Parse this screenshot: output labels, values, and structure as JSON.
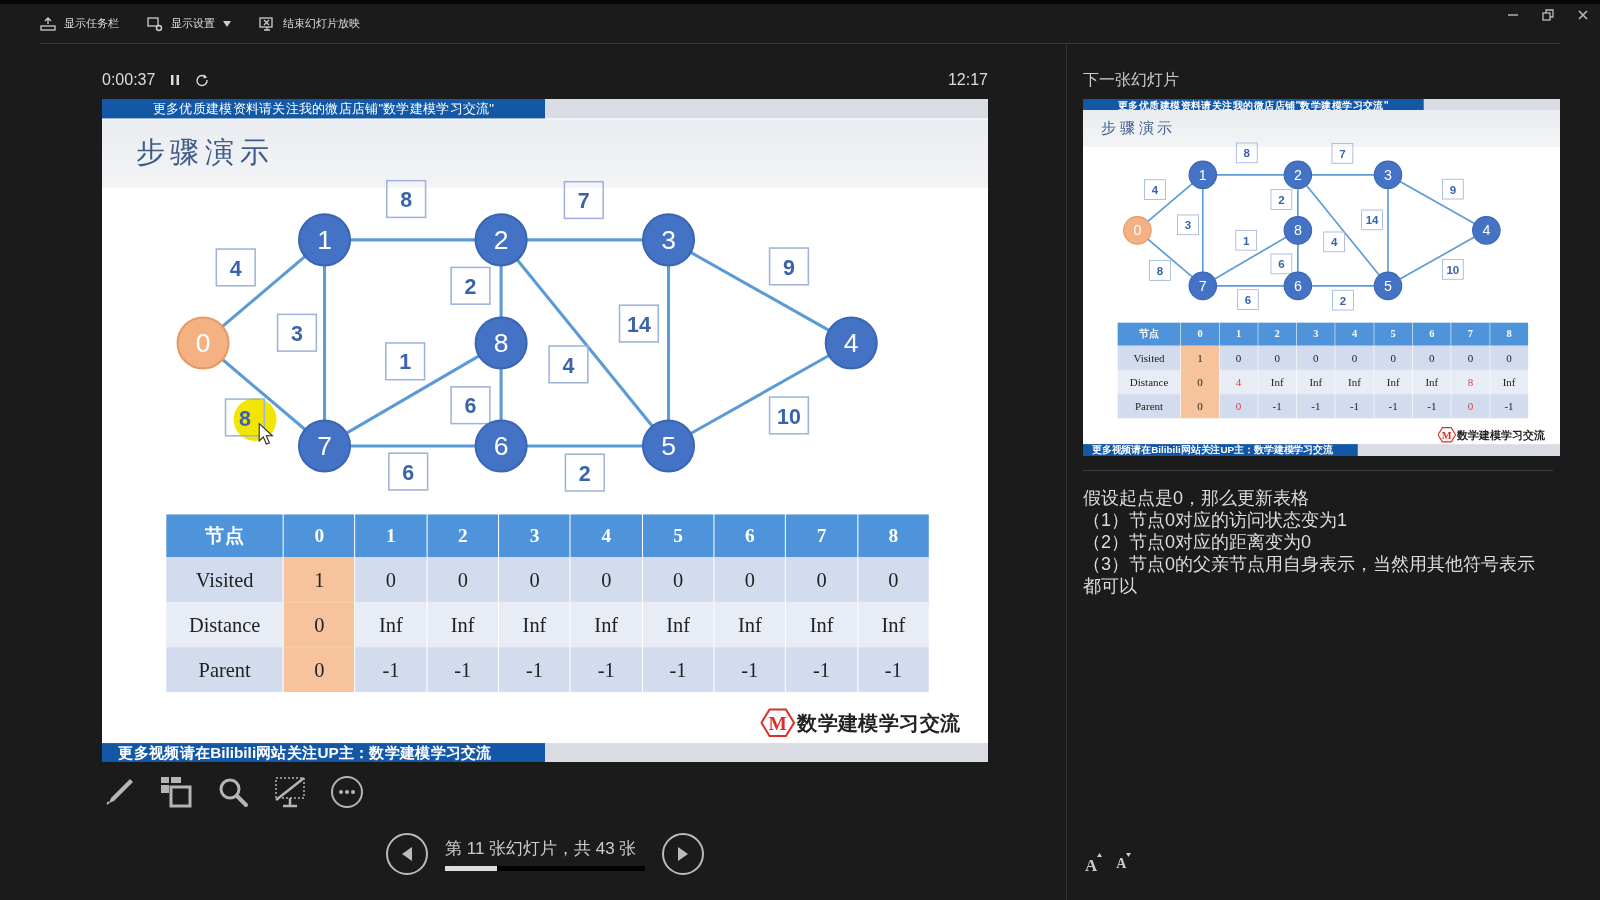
{
  "toolbar": [
    {
      "label": "显示任务栏",
      "kind": "taskbar",
      "dropdown": false
    },
    {
      "label": "显示设置",
      "kind": "settings",
      "dropdown": true
    },
    {
      "label": "结束幻灯片放映",
      "kind": "end",
      "dropdown": false
    }
  ],
  "timer": {
    "elapsed": "0:00:37",
    "clock": "12:17"
  },
  "current_slide": {
    "banner_top": "更多优质建模资料请关注我的微店店铺\"数学建模学习交流\"",
    "title": "步骤演示",
    "nodes": [
      {
        "label": "1",
        "highlighted": false
      },
      {
        "label": "2",
        "highlighted": false
      },
      {
        "label": "3",
        "highlighted": false
      },
      {
        "label": "0",
        "highlighted": true
      },
      {
        "label": "8",
        "highlighted": false
      },
      {
        "label": "4",
        "highlighted": false
      },
      {
        "label": "7",
        "highlighted": false
      },
      {
        "label": "6",
        "highlighted": false
      },
      {
        "label": "5",
        "highlighted": false
      }
    ],
    "edges": [
      {
        "weight": "4"
      },
      {
        "weight": "8"
      },
      {
        "weight": "3"
      },
      {
        "weight": "8"
      },
      {
        "weight": "1"
      },
      {
        "weight": "6"
      },
      {
        "weight": "2"
      },
      {
        "weight": "6"
      },
      {
        "weight": "7"
      },
      {
        "weight": "4"
      },
      {
        "weight": "14"
      },
      {
        "weight": "2"
      },
      {
        "weight": "9"
      },
      {
        "weight": "10"
      }
    ],
    "table": {
      "header": [
        "节点",
        "0",
        "1",
        "2",
        "3",
        "4",
        "5",
        "6",
        "7",
        "8"
      ],
      "rows": [
        {
          "label": "Visited",
          "cells": [
            {
              "text": "1",
              "highlighted": true,
              "changed": false
            },
            {
              "text": "0",
              "highlighted": false,
              "changed": false
            },
            {
              "text": "0",
              "highlighted": false,
              "changed": false
            },
            {
              "text": "0",
              "highlighted": false,
              "changed": false
            },
            {
              "text": "0",
              "highlighted": false,
              "changed": false
            },
            {
              "text": "0",
              "highlighted": false,
              "changed": false
            },
            {
              "text": "0",
              "highlighted": false,
              "changed": false
            },
            {
              "text": "0",
              "highlighted": false,
              "changed": false
            },
            {
              "text": "0",
              "highlighted": false,
              "changed": false
            }
          ]
        },
        {
          "label": "Distance",
          "cells": [
            {
              "text": "0",
              "highlighted": true,
              "changed": false
            },
            {
              "text": "Inf",
              "highlighted": false,
              "changed": false
            },
            {
              "text": "Inf",
              "highlighted": false,
              "changed": false
            },
            {
              "text": "Inf",
              "highlighted": false,
              "changed": false
            },
            {
              "text": "Inf",
              "highlighted": false,
              "changed": false
            },
            {
              "text": "Inf",
              "highlighted": false,
              "changed": false
            },
            {
              "text": "Inf",
              "highlighted": false,
              "changed": false
            },
            {
              "text": "Inf",
              "highlighted": false,
              "changed": false
            },
            {
              "text": "Inf",
              "highlighted": false,
              "changed": false
            }
          ]
        },
        {
          "label": "Parent",
          "cells": [
            {
              "text": "0",
              "highlighted": true,
              "changed": false
            },
            {
              "text": "-1",
              "highlighted": false,
              "changed": false
            },
            {
              "text": "-1",
              "highlighted": false,
              "changed": false
            },
            {
              "text": "-1",
              "highlighted": false,
              "changed": false
            },
            {
              "text": "-1",
              "highlighted": false,
              "changed": false
            },
            {
              "text": "-1",
              "highlighted": false,
              "changed": false
            },
            {
              "text": "-1",
              "highlighted": false,
              "changed": false
            },
            {
              "text": "-1",
              "highlighted": false,
              "changed": false
            },
            {
              "text": "-1",
              "highlighted": false,
              "changed": false
            }
          ]
        }
      ]
    },
    "logo": {
      "mark": "M",
      "text": "数学建模学习交流"
    },
    "banner_bottom": "更多视频请在Bilibili网站关注UP主：数学建模学习交流"
  },
  "navigation": {
    "text": "第 11 张幻灯片，共 43 张",
    "level": 0.26
  },
  "next_slide_label": "下一张幻灯片",
  "next_slide": {
    "banner_top": "更多优质建模资料请关注我的微店店铺\"数学建模学习交流\"",
    "title": "步骤演示",
    "nodes": [
      {
        "label": "1",
        "highlighted": false
      },
      {
        "label": "2",
        "highlighted": false
      },
      {
        "label": "3",
        "highlighted": false
      },
      {
        "label": "0",
        "highlighted": true
      },
      {
        "label": "8",
        "highlighted": false
      },
      {
        "label": "4",
        "highlighted": false
      },
      {
        "label": "7",
        "highlighted": false
      },
      {
        "label": "6",
        "highlighted": false
      },
      {
        "label": "5",
        "highlighted": false
      }
    ],
    "edges": [
      {
        "weight": "4"
      },
      {
        "weight": "8"
      },
      {
        "weight": "3"
      },
      {
        "weight": "8"
      },
      {
        "weight": "1"
      },
      {
        "weight": "6"
      },
      {
        "weight": "2"
      },
      {
        "weight": "6"
      },
      {
        "weight": "7"
      },
      {
        "weight": "4"
      },
      {
        "weight": "14"
      },
      {
        "weight": "2"
      },
      {
        "weight": "9"
      },
      {
        "weight": "10"
      }
    ],
    "table": {
      "header": [
        "节点",
        "0",
        "1",
        "2",
        "3",
        "4",
        "5",
        "6",
        "7",
        "8"
      ],
      "rows": [
        {
          "label": "Visited",
          "cells": [
            {
              "text": "1",
              "highlighted": true,
              "changed": false
            },
            {
              "text": "0",
              "highlighted": false,
              "changed": false
            },
            {
              "text": "0",
              "highlighted": false,
              "changed": false
            },
            {
              "text": "0",
              "highlighted": false,
              "changed": false
            },
            {
              "text": "0",
              "highlighted": false,
              "changed": false
            },
            {
              "text": "0",
              "highlighted": false,
              "changed": false
            },
            {
              "text": "0",
              "highlighted": false,
              "changed": false
            },
            {
              "text": "0",
              "highlighted": false,
              "changed": false
            },
            {
              "text": "0",
              "highlighted": false,
              "changed": false
            }
          ]
        },
        {
          "label": "Distance",
          "cells": [
            {
              "text": "0",
              "highlighted": true,
              "changed": false
            },
            {
              "text": "4",
              "highlighted": false,
              "changed": true
            },
            {
              "text": "Inf",
              "highlighted": false,
              "changed": false
            },
            {
              "text": "Inf",
              "highlighted": false,
              "changed": false
            },
            {
              "text": "Inf",
              "highlighted": false,
              "changed": false
            },
            {
              "text": "Inf",
              "highlighted": false,
              "changed": false
            },
            {
              "text": "Inf",
              "highlighted": false,
              "changed": false
            },
            {
              "text": "8",
              "highlighted": false,
              "changed": true
            },
            {
              "text": "Inf",
              "highlighted": false,
              "changed": false
            }
          ]
        },
        {
          "label": "Parent",
          "cells": [
            {
              "text": "0",
              "highlighted": true,
              "changed": false
            },
            {
              "text": "0",
              "highlighted": false,
              "changed": true
            },
            {
              "text": "-1",
              "highlighted": false,
              "changed": false
            },
            {
              "text": "-1",
              "highlighted": false,
              "changed": false
            },
            {
              "text": "-1",
              "highlighted": false,
              "changed": false
            },
            {
              "text": "-1",
              "highlighted": false,
              "changed": false
            },
            {
              "text": "-1",
              "highlighted": false,
              "changed": false
            },
            {
              "text": "0",
              "highlighted": false,
              "changed": true
            },
            {
              "text": "-1",
              "highlighted": false,
              "changed": false
            }
          ]
        }
      ]
    },
    "logo": {
      "mark": "M",
      "text": "数学建模学习交流"
    },
    "banner_bottom": "更多视频请在Bilibili网站关注UP主：数学建模学习交流"
  },
  "notes": [
    "假设起点是0，那么更新表格",
    "（1）节点0对应的访问状态变为1",
    "（2）节点0对应的距离变为0",
    "（3）节点0的父亲节点用自身表示，当然用其他符号表示都可以"
  ],
  "font_size_buttons": [
    {
      "label": "A",
      "kind": "increase"
    },
    {
      "label": "A",
      "kind": "decrease"
    }
  ]
}
